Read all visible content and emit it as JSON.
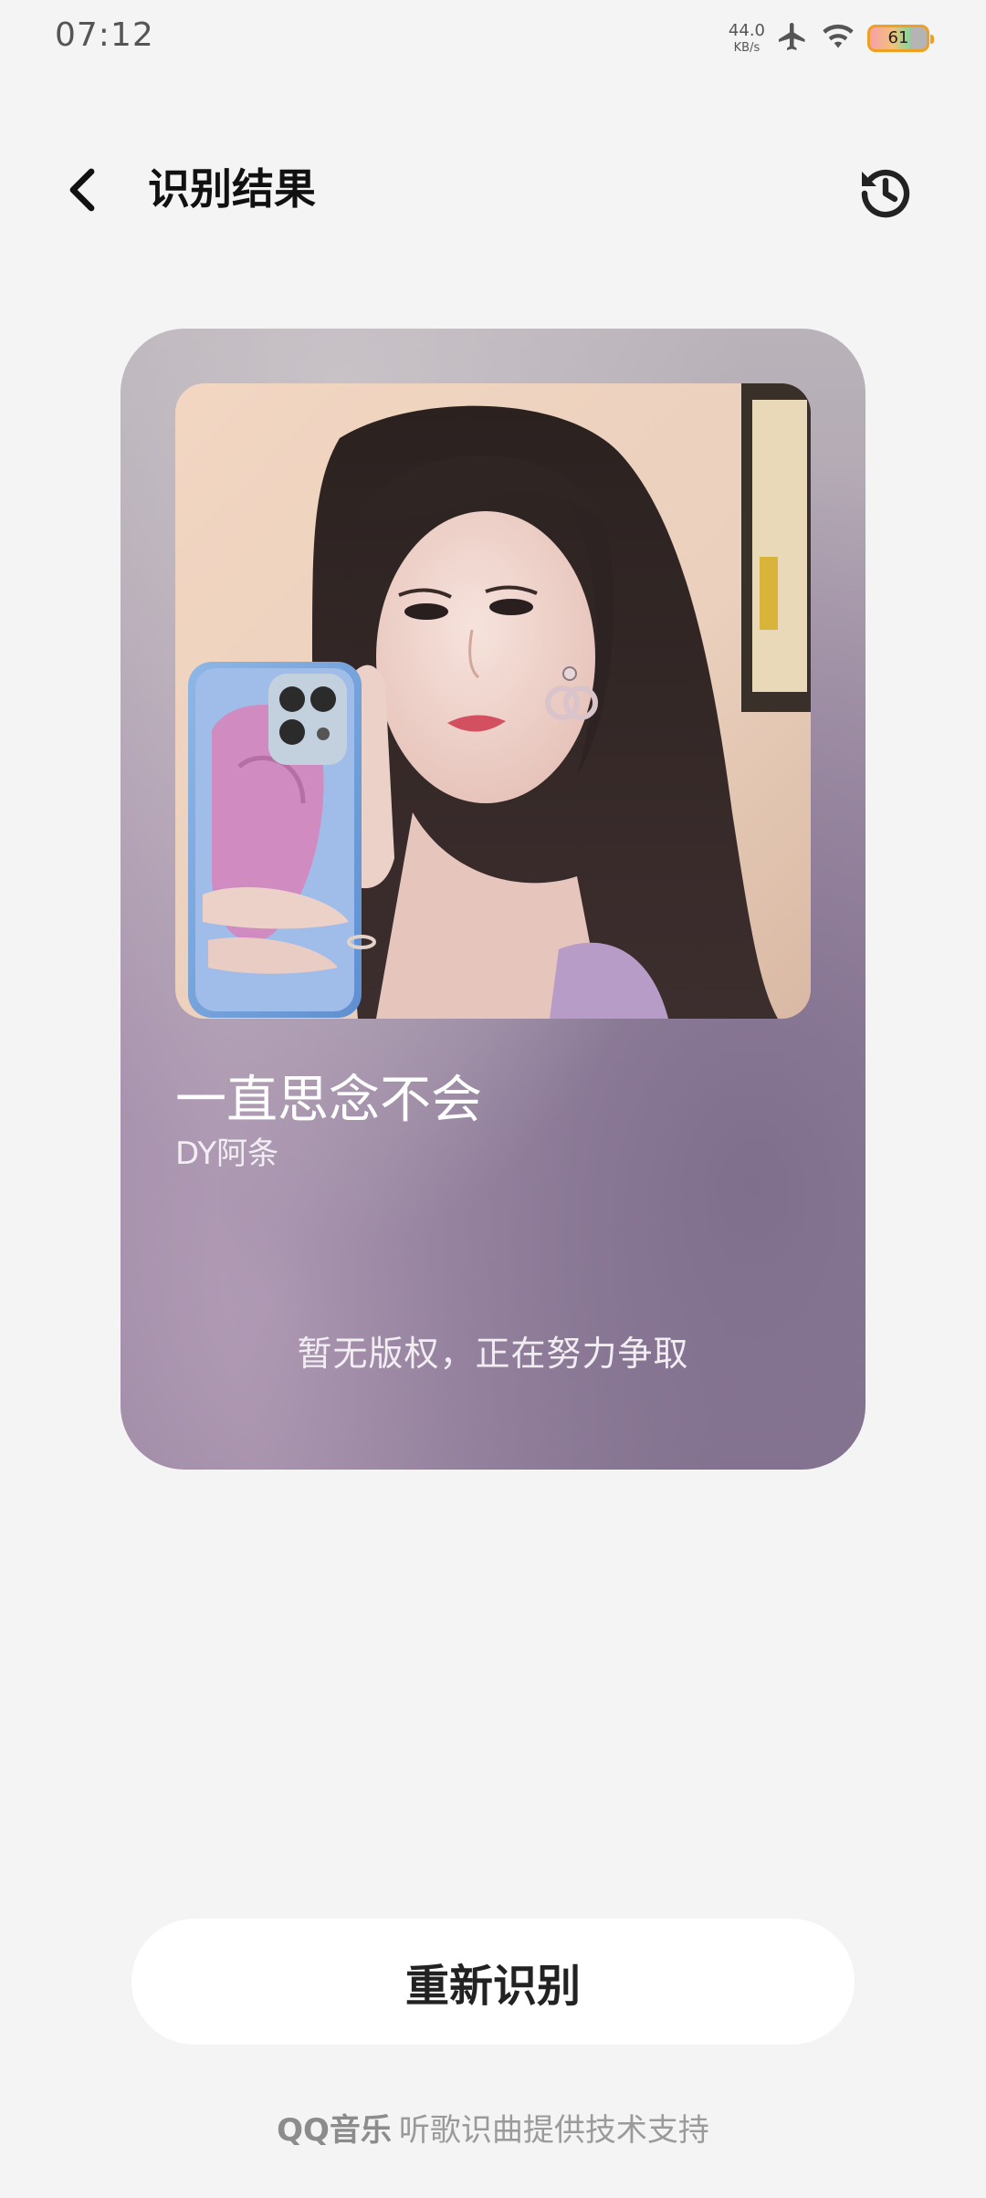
{
  "status_bar": {
    "time": "07:12",
    "net_speed_value": "44.0",
    "net_speed_unit": "KB/s",
    "battery_level": "61",
    "icons": [
      "airplane-icon",
      "wifi-icon",
      "battery-icon"
    ]
  },
  "header": {
    "title": "识别结果",
    "back_icon": "chevron-left-icon",
    "history_icon": "history-icon"
  },
  "result": {
    "song_title": "一直思念不会",
    "artist": "DY阿条",
    "copyright_note": "暂无版权，正在努力争取"
  },
  "actions": {
    "retry_label": "重新识别"
  },
  "footer": {
    "brand": "QQ音乐",
    "text": "听歌识曲提供技术支持"
  },
  "colors": {
    "background": "#f4f4f4",
    "card_gradient_top": "#b9b3b9",
    "card_gradient_bottom": "#8a7893",
    "battery_border": "#f0a020"
  }
}
